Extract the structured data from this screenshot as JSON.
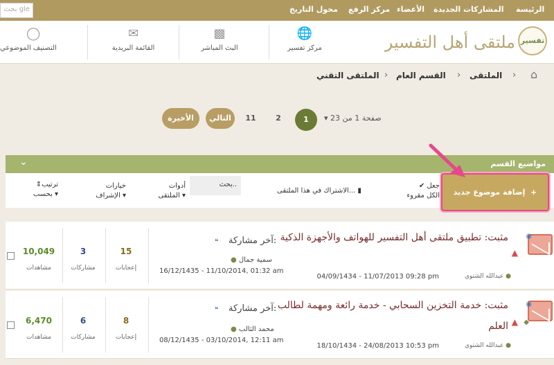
{
  "topnav": {
    "search_placeholder": "بحث gle",
    "links": [
      "الرئيسة",
      "المشاركات الجديدة",
      "الأعضاء",
      "مركز الرفع",
      "محول التاريخ"
    ]
  },
  "header": {
    "items": [
      {
        "label": "مركز تفسير",
        "icon": "globe-icon"
      },
      {
        "label": "البث المباشر",
        "icon": "monitor-icon"
      },
      {
        "label": "القائمة البريدية",
        "icon": "mail-icon"
      },
      {
        "label": "التصنيف الموضوعي",
        "icon": "tag-icon"
      }
    ],
    "logo_text": "ملتقى أهل التفسير",
    "logo_mark": "تفسير"
  },
  "breadcrumb": [
    "الملتقى",
    "القسم العام",
    "الملتقى التقني"
  ],
  "pagination": {
    "info": "صفحة 1 من 23",
    "current": "1",
    "pages": [
      "2",
      "11"
    ],
    "next": "التالي",
    "last": "الأخيرة"
  },
  "section": {
    "title": "مواضيع القسم",
    "new_topic": "إضافة موضوع جديد",
    "mark_read": "جعل الكل مقروء",
    "subscribe": "الاشتراك في هذا الملتقى...",
    "search": "بحث..",
    "tools": "أدوات الملتقى",
    "moderation": "خيارات الإشراف",
    "sort": "ترتيب بحسب"
  },
  "threads": [
    {
      "prefix": "مثبت:",
      "title": "تطبيق ملتقى أهل التفسير للهواتف والأجهزة الذكية",
      "starter": "عبدالله الشتوي",
      "started": "04/09/1434 - 11/07/2013 09:28 pm",
      "last_label": "آخر مشاركة:",
      "last_user": "سمية جمال",
      "last_date": "16/12/1435 - 11/10/2014, 01:32 am",
      "replies": "15",
      "replies_label": "إعجابات",
      "posts": "3",
      "posts_label": "مشاركات",
      "views": "10,049",
      "views_label": "مشاهدات"
    },
    {
      "prefix": "مثبت:",
      "title": "خدمة التخزين السحابي - خدمة رائعة ومهمة لطالب العلم",
      "starter": "عبدالله الشتوي",
      "started": "18/10/1434 - 24/08/2013 10:53 pm",
      "last_label": "آخر مشاركة:",
      "last_user": "محمد الثالب",
      "last_date": "08/12/1435 - 03/10/2014, 12:11 am",
      "replies": "8",
      "replies_label": "إعجابات",
      "posts": "6",
      "posts_label": "مشاركات",
      "views": "6,470",
      "views_label": "مشاهدات"
    }
  ],
  "colors": {
    "accent": "#b09a60",
    "section_bar": "#a5b56d",
    "current_page": "#6b7a35",
    "highlight": "#e6498a"
  }
}
